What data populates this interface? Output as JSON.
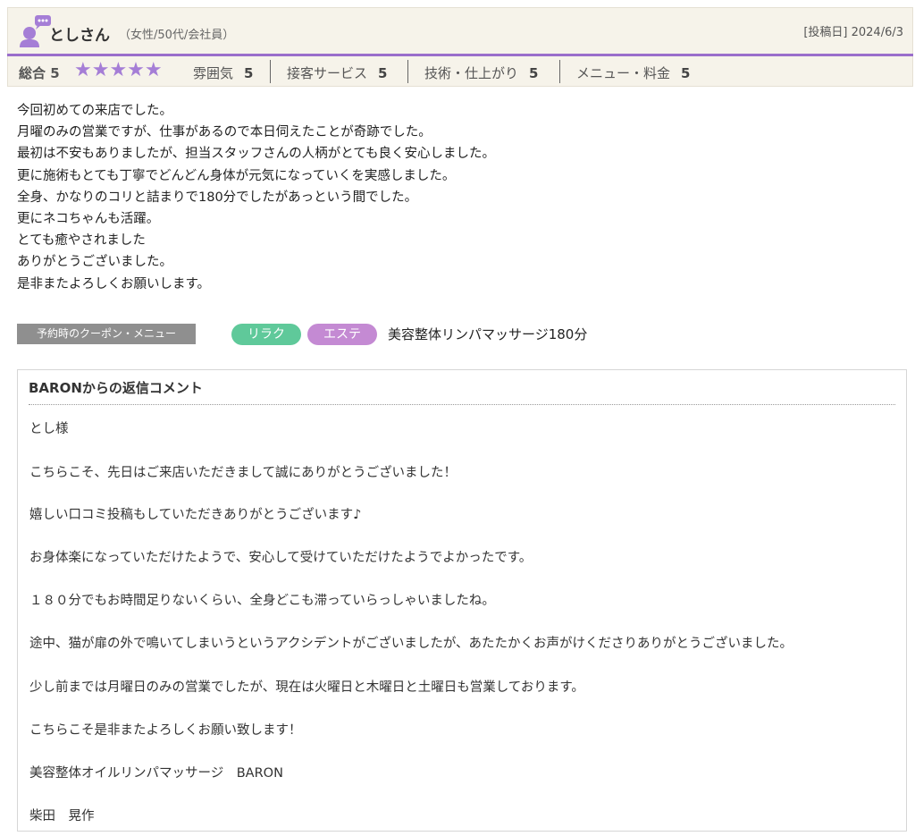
{
  "header": {
    "user_name": "としさん",
    "user_meta": "（女性/50代/会社員）",
    "post_date": "[投稿日] 2024/6/3"
  },
  "ratings": {
    "overall_label": "総合 5",
    "overall_value": 5,
    "stars": "★★★★★",
    "star_color": "#a57ed6",
    "items": [
      {
        "label": "雰囲気",
        "value": "5"
      },
      {
        "label": "接客サービス",
        "value": "5"
      },
      {
        "label": "技術・仕上がり",
        "value": "5"
      },
      {
        "label": "メニュー・料金",
        "value": "5"
      }
    ]
  },
  "review": {
    "lines": [
      "今回初めての来店でした。",
      "月曜のみの営業ですが、仕事があるので本日伺えたことが奇跡でした。",
      "最初は不安もありましたが、担当スタッフさんの人柄がとても良く安心しました。",
      "更に施術もとても丁寧でどんどん身体が元気になっていくを実感しました。",
      "全身、かなりのコリと詰まりで180分でしたがあっという間でした。",
      "更にネコちゃんも活躍。",
      "とても癒やされました",
      "ありがとうございました。",
      "是非またよろしくお願いします。"
    ]
  },
  "coupon": {
    "label": "予約時のクーポン・メニュー",
    "tags": [
      "リラク",
      "エステ"
    ],
    "menu": "美容整体リンパマッサージ180分"
  },
  "reply": {
    "title": "BARONからの返信コメント",
    "lines": [
      "とし様",
      "こちらこそ、先日はご来店いただきまして誠にありがとうございました！",
      "嬉しい口コミ投稿もしていただきありがとうございます♪",
      "お身体楽になっていただけたようで、安心して受けていただけたようでよかったです。",
      "１８０分でもお時間足りないくらい、全身どこも滞っていらっしゃいましたね。",
      "途中、猫が扉の外で鳴いてしまいうというアクシデントがございましたが、あたたかくお声がけくださりありがとうございました。",
      "少し前までは月曜日のみの営業でしたが、現在は火曜日と木曜日と土曜日も営業しております。",
      "こちらこそ是非またよろしくお願い致します！",
      "美容整体オイルリンパマッサージ　BARON",
      "柴田　晃作"
    ]
  },
  "colors": {
    "accent_purple": "#9a6ecb",
    "header_bg": "#f6f3ea",
    "tag_relax": "#5fc99a",
    "tag_este": "#c48ad3"
  }
}
